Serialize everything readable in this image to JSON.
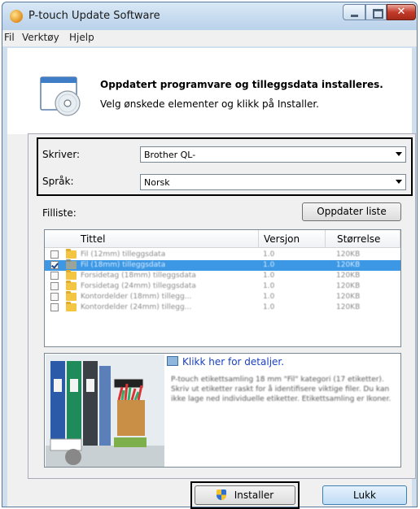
{
  "window": {
    "title": "P-touch Update Software",
    "close_glyph": "✕"
  },
  "menu": [
    "Fil",
    "Verktøy",
    "Hjelp"
  ],
  "header": {
    "title": "Oppdatert programvare og tilleggsdata installeres.",
    "subtitle": "Velg ønskede elementer og klikk på Installer."
  },
  "printer": {
    "label": "Skriver:",
    "value": "Brother QL-"
  },
  "language": {
    "label": "Språk:",
    "value": "Norsk"
  },
  "filelist": {
    "label": "Filliste:",
    "update_button": "Oppdater liste",
    "columns": [
      "Tittel",
      "Versjon",
      "Størrelse"
    ],
    "rows": [
      {
        "checked": false,
        "selected": false,
        "title": "Fil (12mm) tilleggsdata",
        "version": "1.0",
        "size": "120KB"
      },
      {
        "checked": true,
        "selected": true,
        "title": "Fil (18mm) tilleggsdata",
        "version": "1.0",
        "size": "120KB"
      },
      {
        "checked": false,
        "selected": false,
        "title": "Forsidetag (18mm) tilleggsdata",
        "version": "1.0",
        "size": "120KB"
      },
      {
        "checked": false,
        "selected": false,
        "title": "Forsidetag (24mm) tilleggsdata",
        "version": "1.0",
        "size": "120KB"
      },
      {
        "checked": false,
        "selected": false,
        "title": "Kontordelder (18mm) tillegg...",
        "version": "1.0",
        "size": "120KB"
      },
      {
        "checked": false,
        "selected": false,
        "title": "Kontordelder (24mm) tillegg...",
        "version": "1.0",
        "size": "120KB"
      }
    ]
  },
  "details": {
    "link": "Klikk her for detaljer.",
    "description": "P-touch etikettsamling 18 mm \"Fil\" kategori (17 etiketter). Skriv ut etiketter raskt for å identifisere viktige filer. Du kan ikke lage ned individuelle etiketter. Etikettsamling er Ikoner."
  },
  "buttons": {
    "install": "Installer",
    "close": "Lukk"
  }
}
